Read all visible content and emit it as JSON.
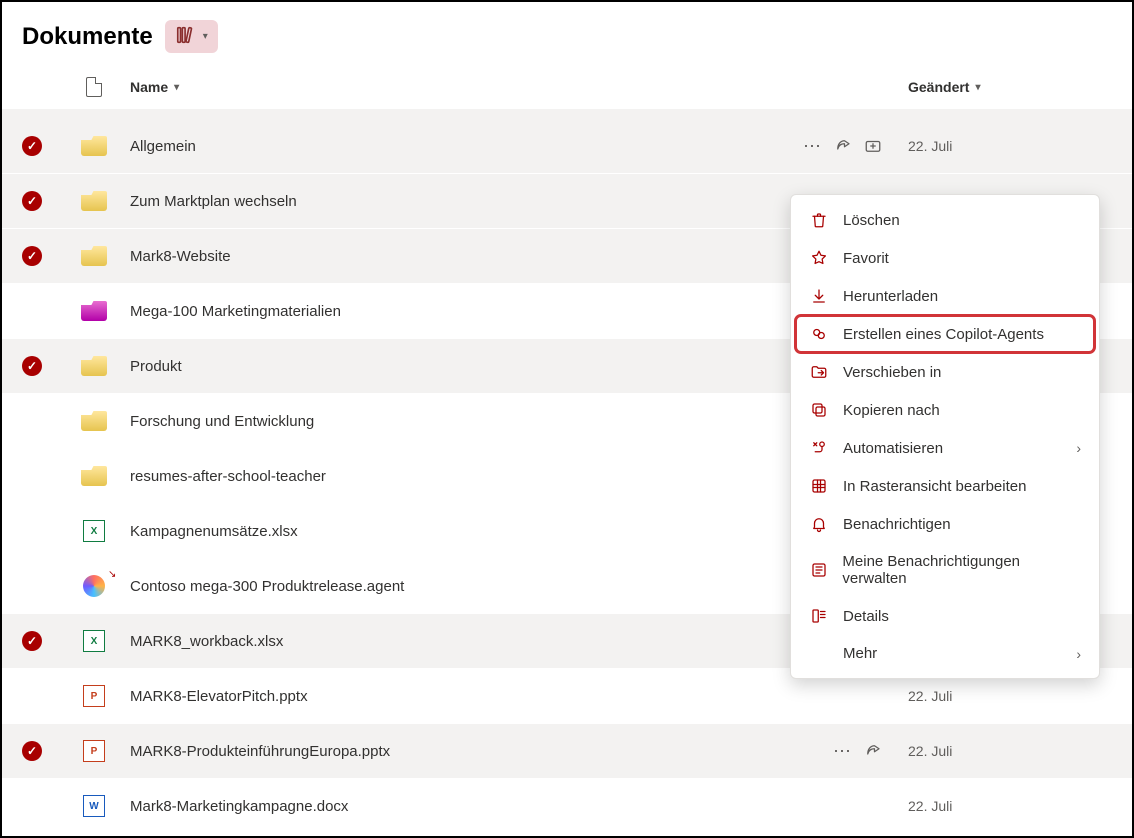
{
  "header": {
    "title": "Dokumente"
  },
  "columns": {
    "name": "Name",
    "changed": "Geändert"
  },
  "dates": {
    "d": "22. Juli"
  },
  "files": [
    {
      "name": "Allgemein",
      "icon": "folder-yellow",
      "selected": true,
      "hoverActions": true,
      "date": "22. Juli"
    },
    {
      "name": "Zum Marktplan wechseln",
      "icon": "folder-yellow",
      "selected": true,
      "hoverActions": false,
      "dotsOnly": true
    },
    {
      "name": "Mark8-Website",
      "icon": "folder-yellow",
      "selected": true,
      "hoverActions": false,
      "dotsOnly": true
    },
    {
      "name": "Mega-100 Marketingmaterialien",
      "icon": "folder-magenta",
      "selected": false
    },
    {
      "name": "Produkt",
      "icon": "folder-yellow",
      "selected": true,
      "hoverActions": false,
      "dotsOnly": true
    },
    {
      "name": "Forschung und Entwicklung",
      "icon": "folder-yellow",
      "selected": false
    },
    {
      "name": "resumes-after-school-teacher",
      "icon": "folder-yellow",
      "selected": false
    },
    {
      "name": "Kampagnenumsätze.xlsx",
      "icon": "xlsx",
      "selected": false
    },
    {
      "name": "Contoso mega-300 Produktrelease.agent",
      "icon": "agent",
      "selected": false,
      "linkBadge": true
    },
    {
      "name": "MARK8_workback.xlsx",
      "icon": "xlsx",
      "selected": true
    },
    {
      "name": "MARK8-ElevatorPitch.pptx",
      "icon": "pptx",
      "selected": false,
      "date": "22. Juli"
    },
    {
      "name": "MARK8-ProdukteinführungEuropa.pptx",
      "icon": "pptx",
      "selected": true,
      "hoverActions": false,
      "dotsShare": true,
      "date": "22. Juli"
    },
    {
      "name": "Mark8-Marketingkampagne.docx",
      "icon": "docx",
      "selected": false,
      "date": "22. Juli"
    }
  ],
  "contextMenu": [
    {
      "id": "delete",
      "label": "Löschen",
      "icon": "trash"
    },
    {
      "id": "favorite",
      "label": "Favorit",
      "icon": "star"
    },
    {
      "id": "download",
      "label": "Herunterladen",
      "icon": "download"
    },
    {
      "id": "create-agent",
      "label": "Erstellen eines Copilot-Agents",
      "icon": "copilot",
      "highlighted": true
    },
    {
      "id": "move-to",
      "label": "Verschieben in",
      "icon": "folder-move"
    },
    {
      "id": "copy-to",
      "label": "Kopieren nach",
      "icon": "copy"
    },
    {
      "id": "automate",
      "label": "Automatisieren",
      "icon": "flow",
      "submenu": true
    },
    {
      "id": "grid-edit",
      "label": "In Rasteransicht bearbeiten",
      "icon": "grid"
    },
    {
      "id": "notify",
      "label": "Benachrichtigen",
      "icon": "bell"
    },
    {
      "id": "manage-notif",
      "label": "Meine Benachrichtigungen verwalten",
      "icon": "alert-list"
    },
    {
      "id": "details",
      "label": "Details",
      "icon": "details"
    },
    {
      "id": "more",
      "label": "Mehr",
      "icon": "",
      "submenu": true,
      "noicon": true
    }
  ]
}
